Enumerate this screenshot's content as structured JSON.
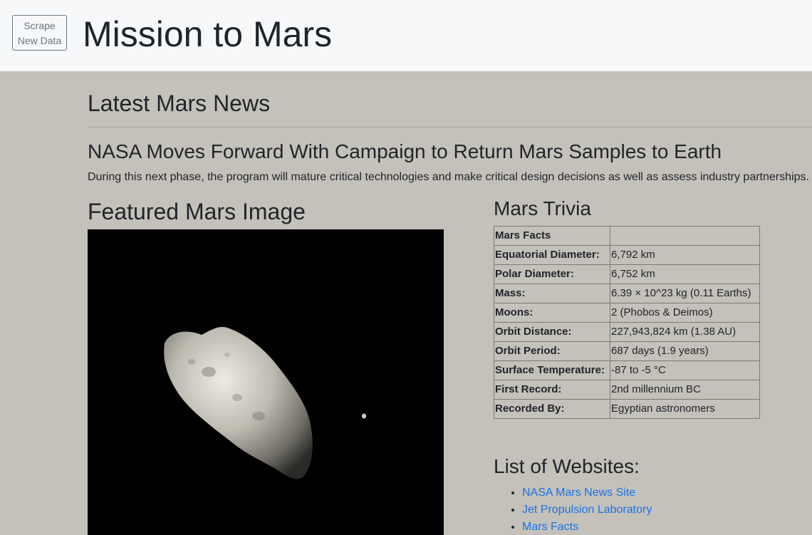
{
  "header": {
    "scrape_button": "Scrape New Data",
    "title": "Mission to Mars"
  },
  "news": {
    "heading": "Latest Mars News",
    "title": "NASA Moves Forward With Campaign to Return Mars Samples to Earth",
    "paragraph": "During this next phase, the program will mature critical technologies and make critical design decisions as well as assess industry partnerships."
  },
  "featured": {
    "heading": "Featured Mars Image"
  },
  "trivia": {
    "heading": "Mars Trivia",
    "rows": [
      {
        "label": "Mars Facts",
        "value": ""
      },
      {
        "label": "Equatorial Diameter:",
        "value": "6,792 km"
      },
      {
        "label": "Polar Diameter:",
        "value": "6,752 km"
      },
      {
        "label": "Mass:",
        "value": "6.39 × 10^23 kg (0.11 Earths)"
      },
      {
        "label": "Moons:",
        "value": "2 (Phobos & Deimos)"
      },
      {
        "label": "Orbit Distance:",
        "value": "227,943,824 km (1.38 AU)"
      },
      {
        "label": "Orbit Period:",
        "value": "687 days (1.9 years)"
      },
      {
        "label": "Surface Temperature:",
        "value": "-87 to -5 °C"
      },
      {
        "label": "First Record:",
        "value": "2nd millennium BC"
      },
      {
        "label": "Recorded By:",
        "value": "Egyptian astronomers"
      }
    ]
  },
  "websites": {
    "heading": "List of Websites:",
    "links": [
      {
        "label": "NASA Mars News Site"
      },
      {
        "label": "Jet Propulsion Laboratory"
      },
      {
        "label": "Mars Facts"
      }
    ]
  },
  "colors": {
    "header_bg": "#f7f8fa",
    "page_bg": "#c4c1ba",
    "link": "#1a73e8"
  }
}
